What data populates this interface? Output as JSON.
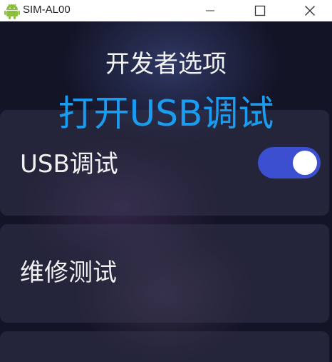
{
  "window": {
    "title": "SIM-AL00",
    "icon": "android-icon",
    "controls": [
      "minimize-icon",
      "maximize-icon",
      "close-icon"
    ]
  },
  "page": {
    "title": "开发者选项",
    "overlay": "打开USB调试"
  },
  "settings": [
    {
      "label": "USB调试",
      "toggle": true
    },
    {
      "label": "维修测试"
    }
  ],
  "colors": {
    "background": "#141427",
    "toggle_on": "#3b4fd0",
    "overlay_text": "#1a9cf0"
  }
}
